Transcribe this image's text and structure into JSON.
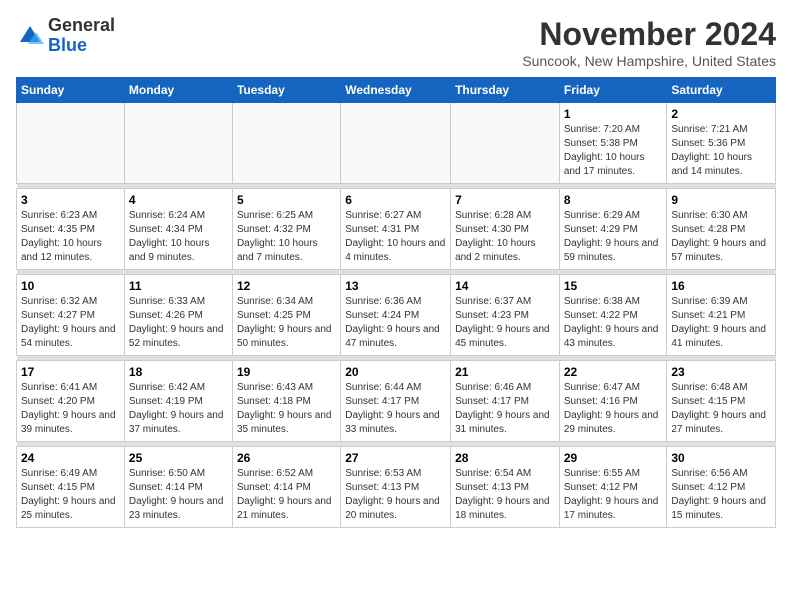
{
  "logo": {
    "general": "General",
    "blue": "Blue"
  },
  "header": {
    "month": "November 2024",
    "location": "Suncook, New Hampshire, United States"
  },
  "weekdays": [
    "Sunday",
    "Monday",
    "Tuesday",
    "Wednesday",
    "Thursday",
    "Friday",
    "Saturday"
  ],
  "weeks": [
    [
      {
        "day": "",
        "info": ""
      },
      {
        "day": "",
        "info": ""
      },
      {
        "day": "",
        "info": ""
      },
      {
        "day": "",
        "info": ""
      },
      {
        "day": "",
        "info": ""
      },
      {
        "day": "1",
        "info": "Sunrise: 7:20 AM\nSunset: 5:38 PM\nDaylight: 10 hours and 17 minutes."
      },
      {
        "day": "2",
        "info": "Sunrise: 7:21 AM\nSunset: 5:36 PM\nDaylight: 10 hours and 14 minutes."
      }
    ],
    [
      {
        "day": "3",
        "info": "Sunrise: 6:23 AM\nSunset: 4:35 PM\nDaylight: 10 hours and 12 minutes."
      },
      {
        "day": "4",
        "info": "Sunrise: 6:24 AM\nSunset: 4:34 PM\nDaylight: 10 hours and 9 minutes."
      },
      {
        "day": "5",
        "info": "Sunrise: 6:25 AM\nSunset: 4:32 PM\nDaylight: 10 hours and 7 minutes."
      },
      {
        "day": "6",
        "info": "Sunrise: 6:27 AM\nSunset: 4:31 PM\nDaylight: 10 hours and 4 minutes."
      },
      {
        "day": "7",
        "info": "Sunrise: 6:28 AM\nSunset: 4:30 PM\nDaylight: 10 hours and 2 minutes."
      },
      {
        "day": "8",
        "info": "Sunrise: 6:29 AM\nSunset: 4:29 PM\nDaylight: 9 hours and 59 minutes."
      },
      {
        "day": "9",
        "info": "Sunrise: 6:30 AM\nSunset: 4:28 PM\nDaylight: 9 hours and 57 minutes."
      }
    ],
    [
      {
        "day": "10",
        "info": "Sunrise: 6:32 AM\nSunset: 4:27 PM\nDaylight: 9 hours and 54 minutes."
      },
      {
        "day": "11",
        "info": "Sunrise: 6:33 AM\nSunset: 4:26 PM\nDaylight: 9 hours and 52 minutes."
      },
      {
        "day": "12",
        "info": "Sunrise: 6:34 AM\nSunset: 4:25 PM\nDaylight: 9 hours and 50 minutes."
      },
      {
        "day": "13",
        "info": "Sunrise: 6:36 AM\nSunset: 4:24 PM\nDaylight: 9 hours and 47 minutes."
      },
      {
        "day": "14",
        "info": "Sunrise: 6:37 AM\nSunset: 4:23 PM\nDaylight: 9 hours and 45 minutes."
      },
      {
        "day": "15",
        "info": "Sunrise: 6:38 AM\nSunset: 4:22 PM\nDaylight: 9 hours and 43 minutes."
      },
      {
        "day": "16",
        "info": "Sunrise: 6:39 AM\nSunset: 4:21 PM\nDaylight: 9 hours and 41 minutes."
      }
    ],
    [
      {
        "day": "17",
        "info": "Sunrise: 6:41 AM\nSunset: 4:20 PM\nDaylight: 9 hours and 39 minutes."
      },
      {
        "day": "18",
        "info": "Sunrise: 6:42 AM\nSunset: 4:19 PM\nDaylight: 9 hours and 37 minutes."
      },
      {
        "day": "19",
        "info": "Sunrise: 6:43 AM\nSunset: 4:18 PM\nDaylight: 9 hours and 35 minutes."
      },
      {
        "day": "20",
        "info": "Sunrise: 6:44 AM\nSunset: 4:17 PM\nDaylight: 9 hours and 33 minutes."
      },
      {
        "day": "21",
        "info": "Sunrise: 6:46 AM\nSunset: 4:17 PM\nDaylight: 9 hours and 31 minutes."
      },
      {
        "day": "22",
        "info": "Sunrise: 6:47 AM\nSunset: 4:16 PM\nDaylight: 9 hours and 29 minutes."
      },
      {
        "day": "23",
        "info": "Sunrise: 6:48 AM\nSunset: 4:15 PM\nDaylight: 9 hours and 27 minutes."
      }
    ],
    [
      {
        "day": "24",
        "info": "Sunrise: 6:49 AM\nSunset: 4:15 PM\nDaylight: 9 hours and 25 minutes."
      },
      {
        "day": "25",
        "info": "Sunrise: 6:50 AM\nSunset: 4:14 PM\nDaylight: 9 hours and 23 minutes."
      },
      {
        "day": "26",
        "info": "Sunrise: 6:52 AM\nSunset: 4:14 PM\nDaylight: 9 hours and 21 minutes."
      },
      {
        "day": "27",
        "info": "Sunrise: 6:53 AM\nSunset: 4:13 PM\nDaylight: 9 hours and 20 minutes."
      },
      {
        "day": "28",
        "info": "Sunrise: 6:54 AM\nSunset: 4:13 PM\nDaylight: 9 hours and 18 minutes."
      },
      {
        "day": "29",
        "info": "Sunrise: 6:55 AM\nSunset: 4:12 PM\nDaylight: 9 hours and 17 minutes."
      },
      {
        "day": "30",
        "info": "Sunrise: 6:56 AM\nSunset: 4:12 PM\nDaylight: 9 hours and 15 minutes."
      }
    ]
  ]
}
